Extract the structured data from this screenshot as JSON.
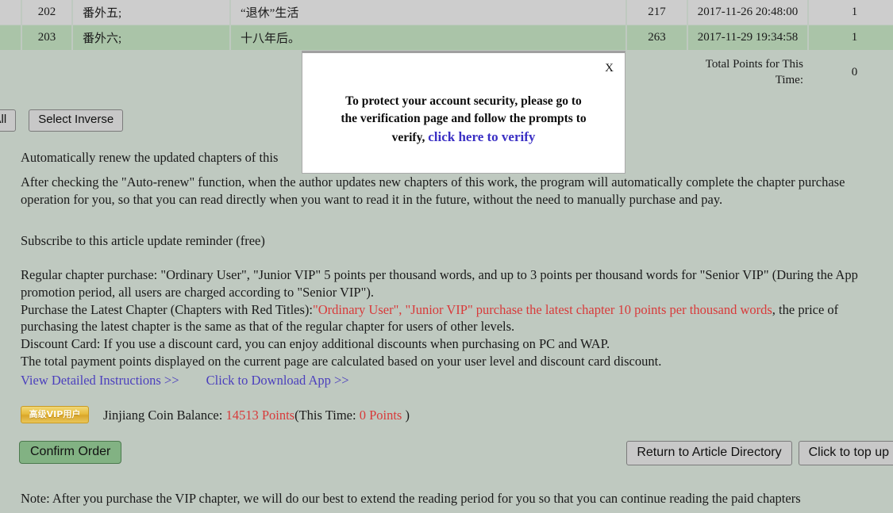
{
  "table": {
    "rows": [
      {
        "number": "202",
        "name": "番外五;",
        "title": "“退休”生活",
        "word_count": "217",
        "date": "2017-11-26 20:48:00",
        "points": "1"
      },
      {
        "number": "203",
        "name": "番外六;",
        "title": "十八年后。",
        "word_count": "263",
        "date": "2017-11-29 19:34:58",
        "points": "1"
      }
    ],
    "total_label": "Total Points for This Time:",
    "total_value": "0"
  },
  "select_bar": {
    "select_all_label": "t All",
    "select_inverse_label": "Select Inverse"
  },
  "content": {
    "auto_renew_heading": "Automatically renew the updated chapters of this",
    "auto_renew_body": "After checking the \"Auto-renew\" function, when the author updates new chapters of this work, the program will automatically complete the chapter purchase operation for you, so that you can read directly when you want to read it in the future, without the need to manually purchase and pay.",
    "subscribe_reminder": "Subscribe to this article update reminder (free)",
    "regular_purchase": "Regular chapter purchase: \"Ordinary User\", \"Junior VIP\" 5 points per thousand words, and up to 3 points per thousand words for \"Senior VIP\" (During the App promotion period, all users are charged according to \"Senior VIP\").",
    "latest_chapter_prefix": "Purchase the Latest Chapter (Chapters with Red Titles):",
    "latest_chapter_red": "\"Ordinary User\", \"Junior VIP\" purchase the latest chapter 10 points per thousand words",
    "latest_chapter_suffix": ", the price of purchasing the latest chapter is the same as that of the regular chapter for users of other levels.",
    "discount_card": "Discount Card: If you use a discount card, you can enjoy additional discounts when purchasing on PC and WAP.",
    "total_payment_note": "The total payment points displayed on the current page are calculated based on your user level and discount card discount.",
    "view_instructions_link": "View Detailed Instructions >>",
    "download_app_link": "Click to Download App >>"
  },
  "balance": {
    "badge_label": "高级VIP用户",
    "label": "Jinjiang Coin Balance:",
    "amount": "14513 Points",
    "this_time_prefix": "(This Time:",
    "this_time_amount": "0 Points",
    "this_time_suffix": ")"
  },
  "footer_buttons": {
    "confirm_order": "Confirm Order",
    "return_directory": "Return to Article Directory",
    "top_up": "Click to top up"
  },
  "note": {
    "text": "Note: After you purchase the VIP chapter, we will do our best to extend the reading period for you so that you can continue reading the paid chapters"
  },
  "modal": {
    "close_label": "X",
    "message": "To protect your account security, please go to the verification page and follow the prompts to verify,",
    "link_label": "click here to verify"
  },
  "colors": {
    "page_background": "#bfc9c0",
    "row_gray": "#cdcdcd",
    "row_green": "#aac4a8",
    "accent_red": "#d83a3a",
    "link_purple": "#4b3fbd",
    "confirm_green": "#82b283",
    "badge_gold": "#e8bb3c"
  }
}
